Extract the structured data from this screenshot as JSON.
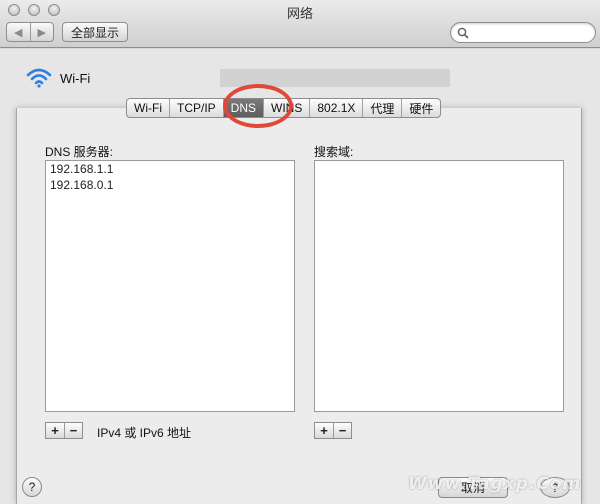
{
  "window": {
    "title": "网络"
  },
  "toolbar": {
    "back_glyph": "◀",
    "forward_glyph": "▶",
    "show_all_label": "全部显示",
    "search_placeholder": ""
  },
  "service": {
    "name": "Wi-Fi",
    "icon": "wifi-icon"
  },
  "tabs": [
    {
      "label": "Wi-Fi",
      "active": false
    },
    {
      "label": "TCP/IP",
      "active": false
    },
    {
      "label": "DNS",
      "active": true
    },
    {
      "label": "WINS",
      "active": false
    },
    {
      "label": "802.1X",
      "active": false
    },
    {
      "label": "代理",
      "active": false
    },
    {
      "label": "硬件",
      "active": false
    }
  ],
  "dns": {
    "servers_label": "DNS 服务器:",
    "servers": [
      "192.168.1.1",
      "192.168.0.1"
    ],
    "address_hint": "IPv4 或 IPv6 地址"
  },
  "search_domains": {
    "label": "搜索域:",
    "items": []
  },
  "controls": {
    "add_glyph": "+",
    "remove_glyph": "−",
    "help_glyph": "?",
    "cancel_label": "取消",
    "help2_glyph": "?"
  },
  "watermark": "Www.Tagxp.Com",
  "colors": {
    "active_tab": "#6b6b6b",
    "highlight_circle": "#e0483a",
    "wifi_blue": "#2f7fe0"
  }
}
